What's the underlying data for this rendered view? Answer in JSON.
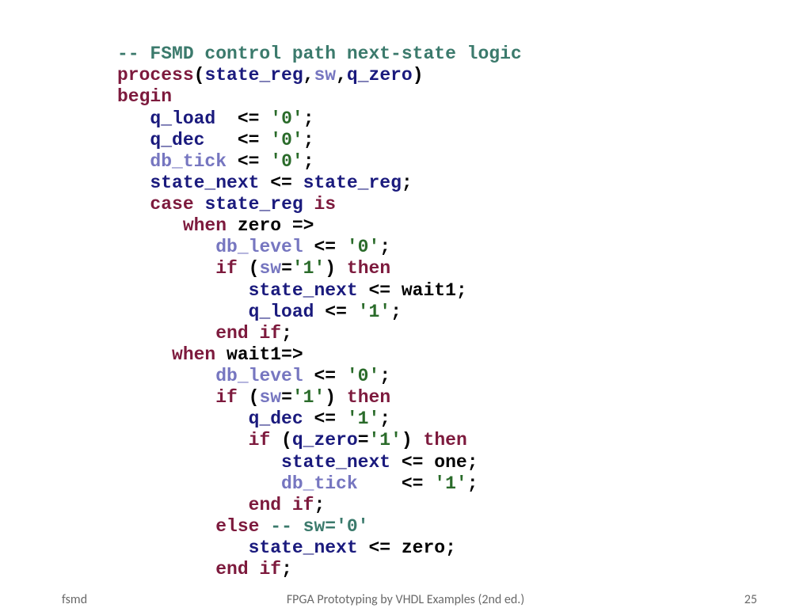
{
  "code": {
    "l01a": "-- FSMD control path next-state logic",
    "l02a": "process",
    "l02b": "(",
    "l02c": "state_reg",
    "l02d": ",",
    "l02e": "sw",
    "l02f": ",",
    "l02g": "q_zero",
    "l02h": ")",
    "l03a": "begin",
    "l04a": "   ",
    "l04b": "q_load",
    "l04c": "  <= ",
    "l04d": "'0'",
    "l04e": ";",
    "l05a": "   ",
    "l05b": "q_dec",
    "l05c": "   <= ",
    "l05d": "'0'",
    "l05e": ";",
    "l06a": "   ",
    "l06b": "db_tick",
    "l06c": " <= ",
    "l06d": "'0'",
    "l06e": ";",
    "l07a": "   ",
    "l07b": "state_next",
    "l07c": " <= ",
    "l07d": "state_reg",
    "l07e": ";",
    "l08a": "   ",
    "l08b": "case",
    "l08c": " ",
    "l08d": "state_reg",
    "l08e": " ",
    "l08f": "is",
    "l09a": "      ",
    "l09b": "when",
    "l09c": " zero =>",
    "l10a": "         ",
    "l10b": "db_level",
    "l10c": " <= ",
    "l10d": "'0'",
    "l10e": ";",
    "l11a": "         ",
    "l11b": "if",
    "l11c": " (",
    "l11d": "sw",
    "l11e": "=",
    "l11f": "'1'",
    "l11g": ") ",
    "l11h": "then",
    "l12a": "            ",
    "l12b": "state_next",
    "l12c": " <= wait1;",
    "l13a": "            ",
    "l13b": "q_load",
    "l13c": " <= ",
    "l13d": "'1'",
    "l13e": ";",
    "l14a": "         ",
    "l14b": "end",
    "l14c": " ",
    "l14d": "if",
    "l14e": ";",
    "l15a": "     ",
    "l15b": "when",
    "l15c": " wait1=>",
    "l16a": "         ",
    "l16b": "db_level",
    "l16c": " <= ",
    "l16d": "'0'",
    "l16e": ";",
    "l17a": "         ",
    "l17b": "if",
    "l17c": " (",
    "l17d": "sw",
    "l17e": "=",
    "l17f": "'1'",
    "l17g": ") ",
    "l17h": "then",
    "l18a": "            ",
    "l18b": "q_dec",
    "l18c": " <= ",
    "l18d": "'1'",
    "l18e": ";",
    "l19a": "            ",
    "l19b": "if",
    "l19c": " (",
    "l19d": "q_zero",
    "l19e": "=",
    "l19f": "'1'",
    "l19g": ") ",
    "l19h": "then",
    "l20a": "               ",
    "l20b": "state_next",
    "l20c": " <= one;",
    "l21a": "               ",
    "l21b": "db_tick",
    "l21c": "    <= ",
    "l21d": "'1'",
    "l21e": ";",
    "l22a": "            ",
    "l22b": "end",
    "l22c": " ",
    "l22d": "if",
    "l22e": ";",
    "l23a": "         ",
    "l23b": "else",
    "l23c": " ",
    "l23d": "-- sw='0'",
    "l24a": "            ",
    "l24b": "state_next",
    "l24c": " <= zero;",
    "l25a": "         ",
    "l25b": "end",
    "l25c": " ",
    "l25d": "if",
    "l25e": ";"
  },
  "footer": {
    "left": "fsmd",
    "center": "FPGA Prototyping by VHDL Examples (2nd ed.)",
    "right": "25"
  }
}
